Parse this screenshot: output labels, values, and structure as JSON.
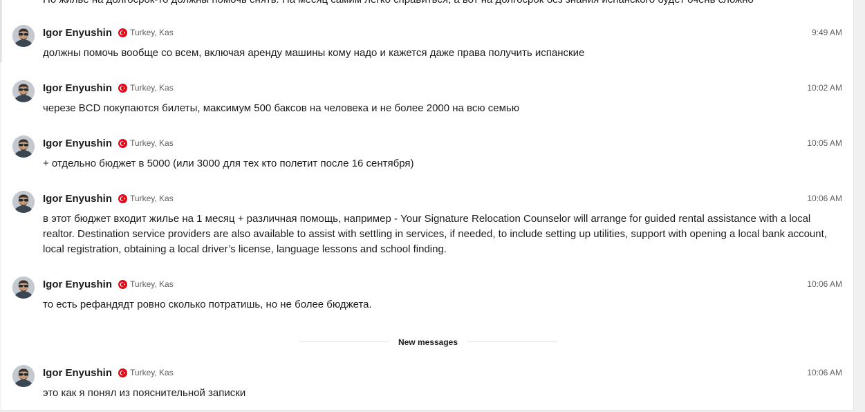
{
  "truncated_previous_message": "Но жилье на долгосрок-то должны помочь снять. На месяц самим легко справиться, а вот на долгосрок без знания испанского будет очень сложно",
  "new_messages_label": "New messages",
  "messages": [
    {
      "author": "Igor Enyushin",
      "location": "Turkey, Kas",
      "flag_icon": "turkey-flag-icon",
      "time": "9:49 AM",
      "text": "должны помочь вообще со всем, включая аренду машины кому надо и кажется даже права получить испанские"
    },
    {
      "author": "Igor Enyushin",
      "location": "Turkey, Kas",
      "flag_icon": "turkey-flag-icon",
      "time": "10:02 AM",
      "text": "черезе BCD покупаются билеты, максимум 500 баксов на человека и не более 2000 на всю семью"
    },
    {
      "author": "Igor Enyushin",
      "location": "Turkey, Kas",
      "flag_icon": "turkey-flag-icon",
      "time": "10:05 AM",
      "text": "+ отдельно бюджет в 5000 (или 3000 для тех кто полетит после 16 сентября)"
    },
    {
      "author": "Igor Enyushin",
      "location": "Turkey, Kas",
      "flag_icon": "turkey-flag-icon",
      "time": "10:06 AM",
      "text": "в этот бюджет входит жилье на 1 месяц + различная помощь, например - Your Signature Relocation Counselor will arrange for guided rental assistance with a local realtor. Destination service providers are also available to assist with settling in services, if needed, to include setting up utilities, support with opening a local bank account, local registration, obtaining a local driver’s license, language lessons and school finding."
    },
    {
      "author": "Igor Enyushin",
      "location": "Turkey, Kas",
      "flag_icon": "turkey-flag-icon",
      "time": "10:06 AM",
      "text": "то есть рефандядт ровно сколько потратишь, но не более бюджета."
    },
    {
      "author": "Igor Enyushin",
      "location": "Turkey, Kas",
      "flag_icon": "turkey-flag-icon",
      "time": "10:06 AM",
      "text": "это как я понял из пояснительной записки"
    }
  ],
  "colors": {
    "text": "#1d1c1d",
    "muted": "#616061",
    "flag_red": "#e30a17"
  }
}
